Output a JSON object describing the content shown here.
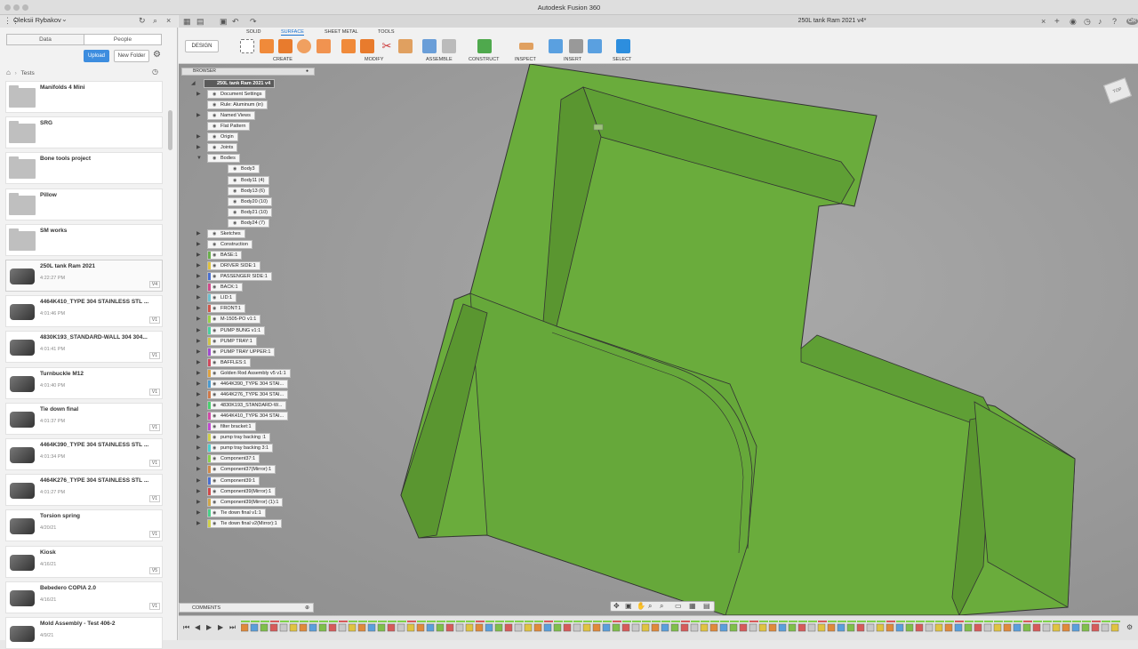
{
  "app": {
    "window_title": "Autodesk Fusion 360",
    "document_tab": "250L tank Ram 2021 v4*"
  },
  "user": {
    "name": "Oleksii Rybakov",
    "initials": "OR"
  },
  "data_panel": {
    "tabs": [
      "Data",
      "People"
    ],
    "upload_label": "Upload",
    "new_folder_label": "New Folder",
    "breadcrumb": "Tests",
    "items": [
      {
        "name": "Manifolds 4 Mini",
        "date": "",
        "version": "",
        "kind": "folder"
      },
      {
        "name": "SRG",
        "date": "",
        "version": "",
        "kind": "folder"
      },
      {
        "name": "Bone tools project",
        "date": "",
        "version": "",
        "kind": "folder"
      },
      {
        "name": "Pillow",
        "date": "",
        "version": "",
        "kind": "folder"
      },
      {
        "name": "SM works",
        "date": "",
        "version": "",
        "kind": "folder"
      },
      {
        "name": "250L tank Ram 2021",
        "date": "4:22:27 PM",
        "version": "V4",
        "kind": "design"
      },
      {
        "name": "4464K410_TYPE 304 STAINLESS STL ...",
        "date": "4:01:46 PM",
        "version": "V1",
        "kind": "design"
      },
      {
        "name": "4830K193_STANDARD-WALL 304 304...",
        "date": "4:01:41 PM",
        "version": "V1",
        "kind": "design"
      },
      {
        "name": "Turnbuckle M12",
        "date": "4:01:40 PM",
        "version": "V1",
        "kind": "design"
      },
      {
        "name": "Tie down final",
        "date": "4:01:37 PM",
        "version": "V1",
        "kind": "design"
      },
      {
        "name": "4464K390_TYPE 304 STAINLESS STL ...",
        "date": "4:01:34 PM",
        "version": "V1",
        "kind": "design"
      },
      {
        "name": "4464K276_TYPE 304 STAINLESS STL ...",
        "date": "4:01:27 PM",
        "version": "V1",
        "kind": "design"
      },
      {
        "name": "Torsion spring",
        "date": "4/20/21",
        "version": "V1",
        "kind": "design"
      },
      {
        "name": "Kiosk",
        "date": "4/16/21",
        "version": "V5",
        "kind": "design"
      },
      {
        "name": "Bebedero COPIA 2.0",
        "date": "4/16/21",
        "version": "V1",
        "kind": "design"
      },
      {
        "name": "Mold Assembly - Test 406-2",
        "date": "4/9/21",
        "version": "",
        "kind": "design"
      }
    ]
  },
  "toolbar": {
    "design_label": "DESIGN",
    "workspace_tabs": [
      "SOLID",
      "SURFACE",
      "SHEET METAL",
      "TOOLS"
    ],
    "active_tab": "SURFACE",
    "groups": [
      "CREATE",
      "MODIFY",
      "ASSEMBLE",
      "CONSTRUCT",
      "INSPECT",
      "INSERT",
      "SELECT"
    ]
  },
  "browser": {
    "title": "BROWSER",
    "root": "250L tank Ram 2021 v4",
    "rows": [
      {
        "label": "Document Settings",
        "level": 1,
        "arrow": "▶"
      },
      {
        "label": "Rule: Aluminum (in)",
        "level": 1,
        "arrow": ""
      },
      {
        "label": "Named Views",
        "level": 1,
        "arrow": "▶"
      },
      {
        "label": "Flat Pattern",
        "level": 1,
        "arrow": ""
      },
      {
        "label": "Origin",
        "level": 1,
        "arrow": "▶"
      },
      {
        "label": "Joints",
        "level": 1,
        "arrow": "▶"
      },
      {
        "label": "Bodies",
        "level": 1,
        "arrow": "▼"
      },
      {
        "label": "Body3",
        "level": 2,
        "arrow": ""
      },
      {
        "label": "Body11 (4)",
        "level": 2,
        "arrow": ""
      },
      {
        "label": "Body13 (6)",
        "level": 2,
        "arrow": ""
      },
      {
        "label": "Body20 (10)",
        "level": 2,
        "arrow": ""
      },
      {
        "label": "Body21 (10)",
        "level": 2,
        "arrow": ""
      },
      {
        "label": "Body24 (7)",
        "level": 2,
        "arrow": ""
      },
      {
        "label": "Sketches",
        "level": 1,
        "arrow": "▶"
      },
      {
        "label": "Construction",
        "level": 1,
        "arrow": "▶"
      },
      {
        "label": "BASE:1",
        "level": 1,
        "arrow": "▶",
        "color": "#6ab04c"
      },
      {
        "label": "DRIVER SIDE:1",
        "level": 1,
        "arrow": "▶",
        "color": "#e0c341"
      },
      {
        "label": "PASSENGER SIDE:1",
        "level": 1,
        "arrow": "▶",
        "color": "#4a6fd1"
      },
      {
        "label": "BACK:1",
        "level": 1,
        "arrow": "▶",
        "color": "#d14a8b"
      },
      {
        "label": "LID:1",
        "level": 1,
        "arrow": "▶",
        "color": "#6fc2d1"
      },
      {
        "label": "FRONT:1",
        "level": 1,
        "arrow": "▶",
        "color": "#d1564a"
      },
      {
        "label": "M-1505-PO v1:1",
        "level": 1,
        "arrow": "▶",
        "color": "#9bd14a"
      },
      {
        "label": "PUMP BUNG v1:1",
        "level": 1,
        "arrow": "▶",
        "color": "#4ad1a1"
      },
      {
        "label": "PUMP TRAY:1",
        "level": 1,
        "arrow": "▶",
        "color": "#d1c54a"
      },
      {
        "label": "PUMP TRAY UPPER:1",
        "level": 1,
        "arrow": "▶",
        "color": "#a14ad1"
      },
      {
        "label": "BAFFLES:1",
        "level": 1,
        "arrow": "▶",
        "color": "#d14a5e"
      },
      {
        "label": "Golden Rod Assembly v5 v1:1",
        "level": 1,
        "arrow": "▶",
        "color": "#e0a341"
      },
      {
        "label": "4464K390_TYPE 304 STAI...",
        "level": 1,
        "arrow": "▶",
        "color": "#4a9bd1"
      },
      {
        "label": "4464K276_TYPE 304 STAI...",
        "level": 1,
        "arrow": "▶",
        "color": "#d17a4a"
      },
      {
        "label": "4830K193_STANDARD-W...",
        "level": 1,
        "arrow": "▶",
        "color": "#4ad16f"
      },
      {
        "label": "4464K410_TYPE 304 STAI...",
        "level": 1,
        "arrow": "▶",
        "color": "#d14aa8"
      },
      {
        "label": "filter bracket:1",
        "level": 1,
        "arrow": "▶",
        "color": "#c14ad1"
      },
      {
        "label": "pump tray backing :1",
        "level": 1,
        "arrow": "▶",
        "color": "#d1d14a"
      },
      {
        "label": "pump tray backing 3:1",
        "level": 1,
        "arrow": "▶",
        "color": "#4ad1d1"
      },
      {
        "label": "Component37:1",
        "level": 1,
        "arrow": "▶",
        "color": "#8ad14a"
      },
      {
        "label": "Component37(Mirror):1",
        "level": 1,
        "arrow": "▶",
        "color": "#d18a4a"
      },
      {
        "label": "Component39:1",
        "level": 1,
        "arrow": "▶",
        "color": "#4a6fd1"
      },
      {
        "label": "Component39(Mirror):1",
        "level": 1,
        "arrow": "▶",
        "color": "#d14a4a"
      },
      {
        "label": "Component39(Mirror) (1):1",
        "level": 1,
        "arrow": "▶",
        "color": "#d1a84a"
      },
      {
        "label": "Tie down final v1:1",
        "level": 1,
        "arrow": "▶",
        "color": "#4ad18a"
      },
      {
        "label": "Tie down final v2(Mirror):1",
        "level": 1,
        "arrow": "▶",
        "color": "#d1d14a"
      }
    ]
  },
  "viewcube": {
    "label": "TOP"
  },
  "comments": {
    "label": "COMMENTS"
  },
  "colors": {
    "accent": "#1a73d2",
    "model_green": "#6aac3c",
    "model_green_dark": "#5a9630",
    "viewport_bg": "#9a9a9a"
  }
}
